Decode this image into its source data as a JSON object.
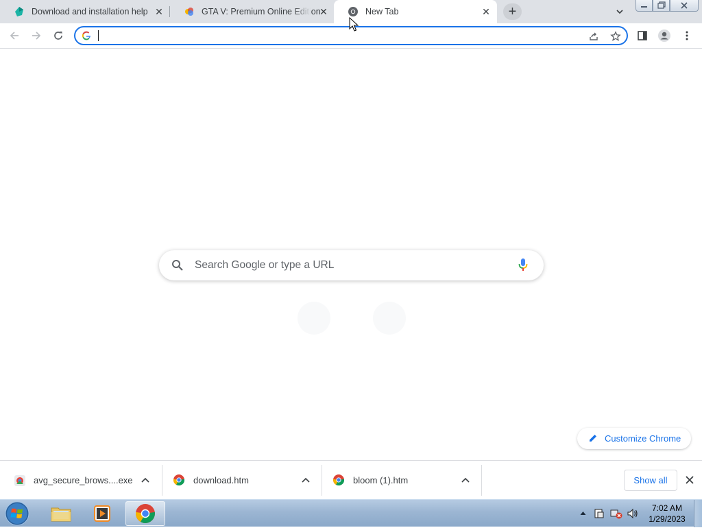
{
  "browser": {
    "tabs": [
      {
        "title": "Download and installation help",
        "icon": "avast-icon",
        "active": false
      },
      {
        "title": "GTA V: Premium Online Edition &",
        "icon": "site-icon",
        "active": false
      },
      {
        "title": "New Tab",
        "icon": "chrome-icon",
        "active": true
      }
    ],
    "new_tab_symbol": "+",
    "close_symbol": "✕",
    "omnibox": {
      "value": "",
      "placeholder": ""
    }
  },
  "ntp": {
    "search_placeholder": "Search Google or type a URL",
    "customize_label": "Customize Chrome"
  },
  "downloads": {
    "items": [
      {
        "name": "avg_secure_brows....exe",
        "icon": "avg-installer-icon"
      },
      {
        "name": "download.htm",
        "icon": "chrome-file-icon"
      },
      {
        "name": "bloom (1).htm",
        "icon": "chrome-file-icon"
      }
    ],
    "show_all_label": "Show all"
  },
  "taskbar": {
    "time": "7:02 AM",
    "date": "1/29/2023"
  },
  "colors": {
    "accent": "#1a73e8",
    "tabstrip": "#dee1e6",
    "taskbar": "#9cb6d3"
  }
}
